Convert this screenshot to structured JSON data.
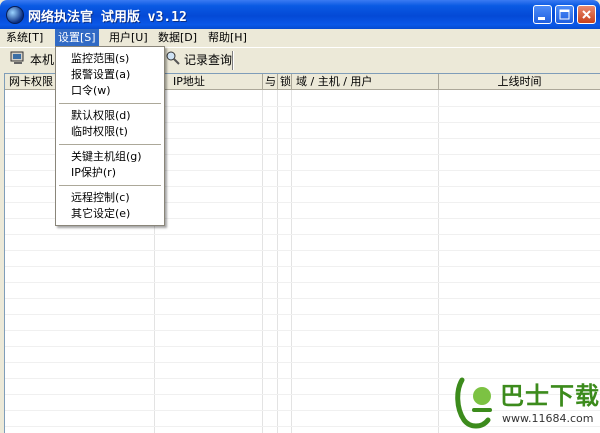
{
  "window": {
    "title": "网络执法官 试用版 v3.12",
    "controls": [
      "minimize",
      "maximize",
      "close"
    ]
  },
  "menubar": {
    "items": [
      {
        "label": "系统[T]"
      },
      {
        "label": "设置[S]",
        "active": true
      },
      {
        "label": "用户[U]"
      },
      {
        "label": "数据[D]"
      },
      {
        "label": "帮助[H]"
      }
    ]
  },
  "tabs": [
    {
      "label": "本机",
      "icon": "computer-icon"
    },
    {
      "label": "记录查询",
      "icon": "magnifier-icon"
    }
  ],
  "dropdown": {
    "groups": [
      [
        "监控范围(s)",
        "报警设置(a)",
        "口令(w)"
      ],
      [
        "默认权限(d)",
        "临时权限(t)"
      ],
      [
        "关键主机组(g)",
        "IP保护(r)"
      ],
      [
        "远程控制(c)",
        "其它设定(e)"
      ]
    ]
  },
  "list": {
    "columns": [
      "网卡权限",
      "IP地址",
      "与",
      "锁",
      "域 / 主机 / 用户",
      "上线时间"
    ],
    "rows": []
  },
  "watermark": {
    "brand": "巴士下载",
    "url": "www.11684.com"
  },
  "colors": {
    "titlebar": "#0449d6",
    "menu_highlight": "#316ac5",
    "window_bg": "#ece9d8",
    "watermark_green": "#3c8b1c"
  }
}
